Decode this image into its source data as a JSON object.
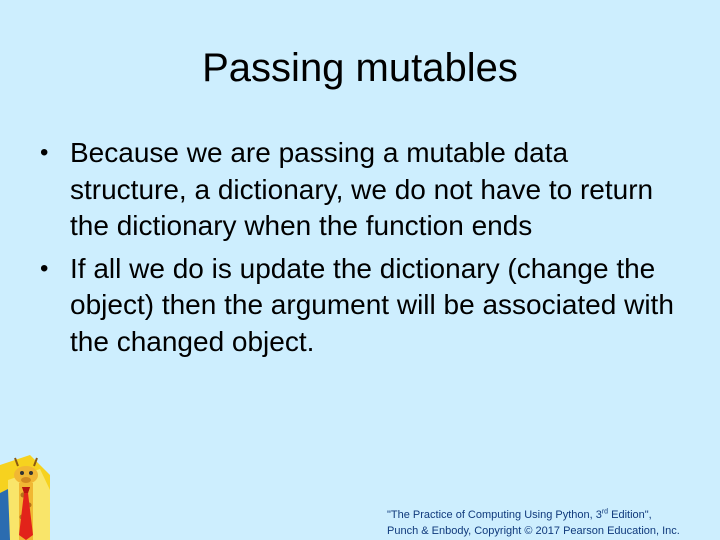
{
  "slide": {
    "title": "Passing mutables",
    "bullets": [
      "Because we are passing a mutable data structure, a dictionary, we do not have to return the dictionary when the function ends",
      "If all we do is update the dictionary (change the object) then the argument will be associated with the changed object."
    ],
    "bullet_glyph": "•"
  },
  "footer": {
    "line1_pre": "\"The Practice of Computing Using Python, 3",
    "line1_sup": "rd",
    "line1_post": " Edition\",",
    "line2": "Punch & Enbody, Copyright © 2017 Pearson Education, Inc."
  },
  "colors": {
    "background": "#cdeefe",
    "footer_text": "#103a7c",
    "logo_red": "#e2231a",
    "logo_yellow": "#f6d21f"
  },
  "logo": {
    "icon": "giraffe-with-tie-icon"
  }
}
